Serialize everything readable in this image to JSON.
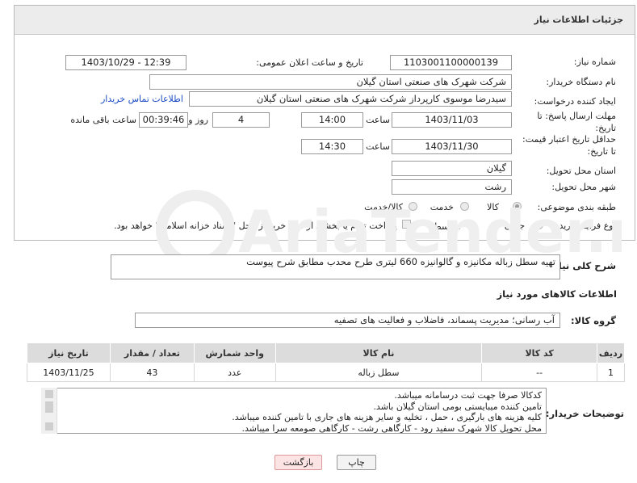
{
  "header": {
    "title": "جزئیات اطلاعات نیاز"
  },
  "form": {
    "need_number_label": "شماره نیاز:",
    "need_number": "1103001100000139",
    "announce_label": "تاریخ و ساعت اعلان عمومی:",
    "announce_value": "1403/10/29 - 12:39",
    "buyer_org_label": "نام دستگاه خریدار:",
    "buyer_org": "شرکت شهرک های صنعتی استان گیلان",
    "requester_label": "ایجاد کننده درخواست:",
    "requester": "سیدرضا موسوی کارپرداز  شرکت شهرک های صنعتی استان گیلان",
    "contact_link": "اطلاعات تماس خریدار",
    "deadline_label": "مهلت ارسال پاسخ: تا تاریخ:",
    "deadline_date": "1403/11/03",
    "time_label": "ساعت",
    "deadline_time": "14:00",
    "days": "4",
    "days_label": "روز و",
    "remaining": "00:39:46",
    "remaining_label": "ساعت باقی مانده",
    "validity_label": "حداقل تاریخ اعتبار قیمت: تا تاریخ:",
    "validity_date": "1403/11/30",
    "validity_time": "14:30",
    "province_label": "استان محل تحویل:",
    "province": "گیلان",
    "city_label": "شهر محل تحویل:",
    "city": "رشت",
    "category_label": "طبقه بندی موضوعی:",
    "category_options": [
      "کالا",
      "خدمت",
      "کالا/خدمت"
    ],
    "purchase_label": "نوع فرآیند خرید :",
    "purchase_options": [
      "جزیی",
      "متوسط"
    ],
    "treasury_text": "پرداخت تمام یا بخشی از مبلغ خرید،از محل \"اسناد خزانه اسلامی\" خواهد بود."
  },
  "summary": {
    "label": "شرح کلی نیاز:",
    "text": "تهیه سطل زباله مکانیزه و گالوانیزه 660 لیتری طرح محدب مطابق شرح پیوست"
  },
  "goods": {
    "section_title": "اطلاعات کالاهای مورد نیاز",
    "group_label": "گروه کالا:",
    "group_value": "آب رسانی؛ مدیریت پسماند، فاضلاب و فعالیت های تصفیه",
    "columns": [
      "ردیف",
      "کد کالا",
      "نام کالا",
      "واحد شمارش",
      "تعداد / مقدار",
      "تاریخ نیاز"
    ],
    "rows": [
      {
        "row": "1",
        "code": "--",
        "name": "سطل زباله",
        "unit": "عدد",
        "qty": "43",
        "date": "1403/11/25"
      }
    ]
  },
  "notes": {
    "label": "توضیحات خریدار:",
    "lines": [
      "کدکالا صرفا جهت ثبت درسامانه میباشد.",
      "تامین کننده میبایستی بومی استان گیلان باشد.",
      "کلیه هزینه های بارگیری ، حمل ، تخلیه و سایر هزینه های جاری با تامین کننده میباشد.",
      "محل تحویل کالا شهرک سفید رود - کارگاهی رشت - کارگاهی صومعه سرا میباشد."
    ]
  },
  "buttons": {
    "print": "چاپ",
    "back": "بازگشت"
  },
  "watermark": {
    "text": "AriaTender.net"
  },
  "colors": {
    "link": "#1a4bc4",
    "back_button_bg": "#fde4e4",
    "print_button_bg": "#f3f3f3",
    "table_header_bg": "#dcdcdc"
  }
}
